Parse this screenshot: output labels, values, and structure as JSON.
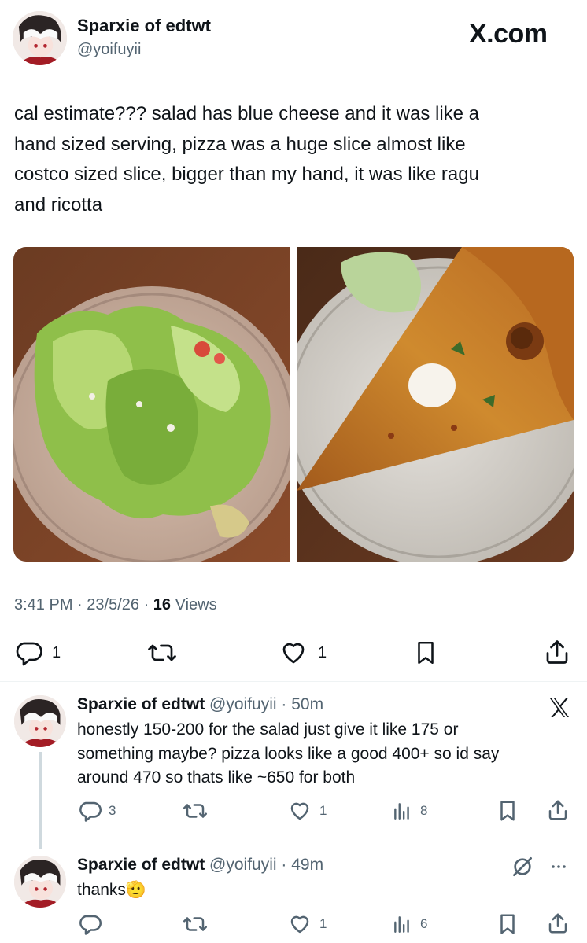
{
  "main_tweet": {
    "author_name": "Sparxie of edtwt",
    "author_handle": "@yoifuyii",
    "watermark": "X.com",
    "text_lines": [
      "cal estimate??? salad has blue cheese and it was like a",
      "hand sized serving, pizza was a huge slice almost like",
      "costco sized slice, bigger than my hand, it was like ragu",
      "and ricotta"
    ],
    "images": [
      {
        "name": "salad-photo",
        "icon": "salad-photo"
      },
      {
        "name": "pizza-photo",
        "icon": "pizza-photo"
      }
    ],
    "meta": {
      "time": "3:41 PM",
      "date": "23/5/26",
      "views_count": "16",
      "views_label": "Views"
    },
    "actions": {
      "reply_count": "1",
      "retweet_count": "",
      "like_count": "1"
    }
  },
  "replies": [
    {
      "author_name": "Sparxie of edtwt",
      "author_handle": "@yoifuyii",
      "time": "50m",
      "text_lines": [
        "honestly 150-200 for the salad just give it like 175 or",
        "something maybe? pizza looks like a good 400+ so id say",
        "around 470 so thats like ~650 for both"
      ],
      "reply_count": "3",
      "like_count": "1",
      "views_count": "8"
    },
    {
      "author_name": "Sparxie of edtwt",
      "author_handle": "@yoifuyii",
      "time": "49m",
      "text": "thanks",
      "emoji": "🫡",
      "reply_count": "",
      "like_count": "1",
      "views_count": "6"
    }
  ],
  "colors": {
    "text": "#0f1419",
    "muted": "#536471",
    "divider": "#eff3f4"
  }
}
